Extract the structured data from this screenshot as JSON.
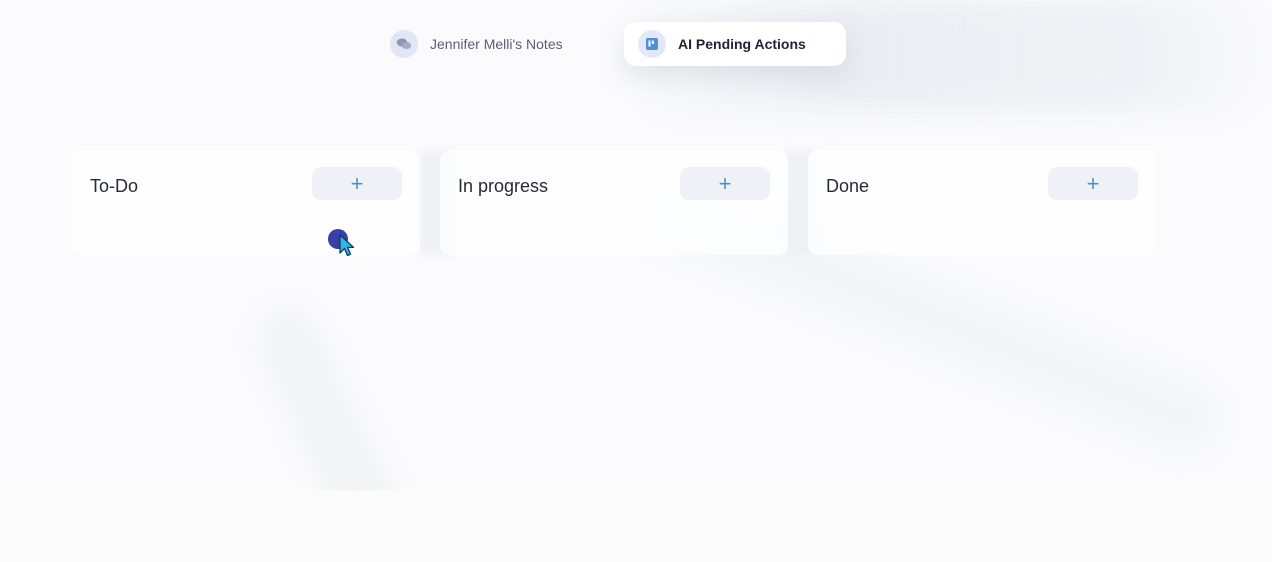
{
  "tabs": [
    {
      "label": "Jennifer Melli's Notes",
      "icon": "chat-bubbles-icon",
      "active": false
    },
    {
      "label": "AI Pending Actions",
      "icon": "board-icon",
      "active": true
    }
  ],
  "columns": [
    {
      "title": "To-Do",
      "add_label": "+"
    },
    {
      "title": "In progress",
      "add_label": "+"
    },
    {
      "title": "Done",
      "add_label": "+"
    }
  ],
  "colors": {
    "accent": "#4d8fc9",
    "cursor": "#3a3fa8",
    "tab_icon_bg": "#e2e5f4"
  }
}
